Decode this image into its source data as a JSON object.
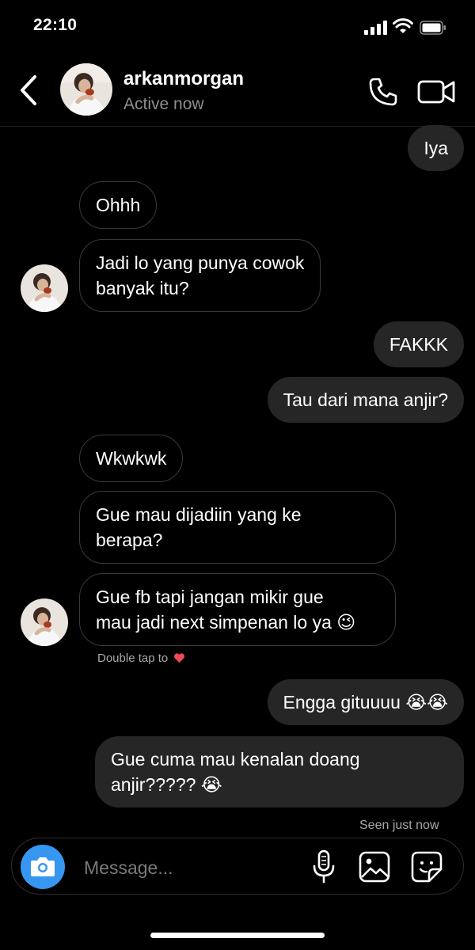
{
  "status_bar": {
    "time": "22:10"
  },
  "header": {
    "username": "arkanmorgan",
    "presence": "Active now"
  },
  "messages": [
    {
      "side": "out",
      "lines": [
        "Iya"
      ]
    },
    {
      "side": "in",
      "lines": [
        "Ohhh"
      ]
    },
    {
      "side": "in",
      "lines": [
        "Jadi lo yang punya cowok",
        "banyak itu?"
      ]
    },
    {
      "side": "out",
      "lines": [
        "FAKKK"
      ]
    },
    {
      "side": "out",
      "lines": [
        "Tau dari mana anjir?"
      ]
    },
    {
      "side": "in",
      "lines": [
        "Wkwkwk"
      ]
    },
    {
      "side": "in",
      "lines": [
        "Gue mau dijadiin yang ke",
        "berapa?"
      ]
    },
    {
      "side": "in",
      "lines": [
        "Gue fb tapi jangan mikir gue",
        "mau jadi next simpenan lo ya 😉"
      ]
    },
    {
      "side": "out",
      "lines": [
        "Engga gituuuu 😭😭"
      ]
    },
    {
      "side": "out",
      "lines": [
        "Gue cuma mau kenalan doang",
        "anjir????? 😭"
      ]
    }
  ],
  "double_tap_hint": "Double tap to",
  "seen_status": "Seen just now",
  "composer": {
    "placeholder": "Message..."
  },
  "icons": {
    "back": "chevron-left-icon",
    "call": "phone-icon",
    "video": "video-camera-icon",
    "camera": "camera-icon",
    "mic": "microphone-icon",
    "gallery": "image-icon",
    "sticker": "sticker-icon",
    "heart": "heart-icon"
  },
  "colors": {
    "accent": "#3797f0",
    "bubble_out": "#262626",
    "heart": "#ed4956"
  }
}
